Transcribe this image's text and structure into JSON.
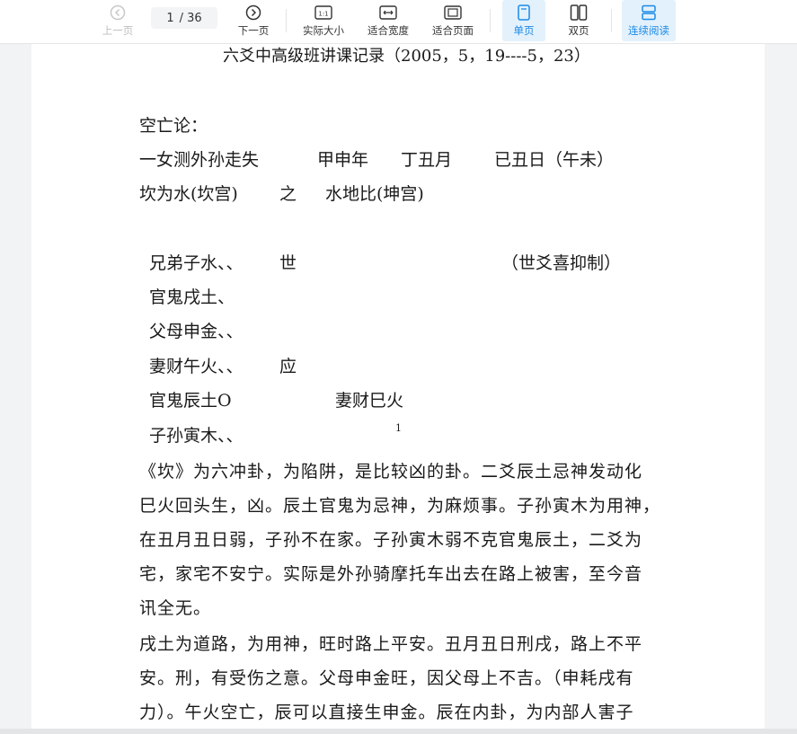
{
  "toolbar": {
    "prev_label": "上一页",
    "page_current": "1",
    "page_total": "/ 36",
    "next_label": "下一页",
    "actual_size_label": "实际大小",
    "fit_width_label": "适合宽度",
    "fit_page_label": "适合页面",
    "single_page_label": "单页",
    "double_page_label": "双页",
    "continuous_label": "连续阅读",
    "accent_color": "#1a8ae6"
  },
  "document": {
    "title": "六爻中高级班讲课记录（2005，5，19----5，23）",
    "section_heading": "空亡论：",
    "case_line": {
      "question": "一女测外孙走失",
      "year": "甲申年",
      "month": "丁丑月",
      "day": "已丑日（午未）"
    },
    "hexagram_line": {
      "main": "坎为水(坎宫)",
      "connector": "之",
      "changed": "水地比(坤宫)"
    },
    "yao": [
      {
        "text": "兄弟子水、、",
        "mark": "世",
        "note": "（世爻喜抑制）"
      },
      {
        "text": "官鬼戌土、",
        "mark": "",
        "note": ""
      },
      {
        "text": "父母申金、、",
        "mark": "",
        "note": ""
      },
      {
        "text": "妻财午火、、",
        "mark": "应",
        "note": ""
      },
      {
        "text": "官鬼辰土O",
        "mark": "",
        "note": "妻财巳火"
      },
      {
        "text": "子孙寅木、、",
        "mark": "",
        "note": ""
      }
    ],
    "footnote_marker": "1",
    "paragraph_1": [
      "《坎》为六冲卦，为陷阱，是比较凶的卦。二爻辰土忌神发动化",
      "巳火回头生，凶。辰土官鬼为忌神，为麻烦事。子孙寅木为用神，",
      "在丑月丑日弱，子孙不在家。子孙寅木弱不克官鬼辰土，二爻为",
      "宅，家宅不安宁。实际是外孙骑摩托车出去在路上被害，至今音",
      "讯全无。"
    ],
    "paragraph_2": [
      "戌土为道路，为用神，旺时路上平安。丑月丑日刑戌，路上不平",
      "安。刑，有受伤之意。父母申金旺，因父母上不吉。（申耗戌有",
      "力）。午火空亡，辰可以直接生申金。辰在内卦，为内部人害子"
    ]
  }
}
